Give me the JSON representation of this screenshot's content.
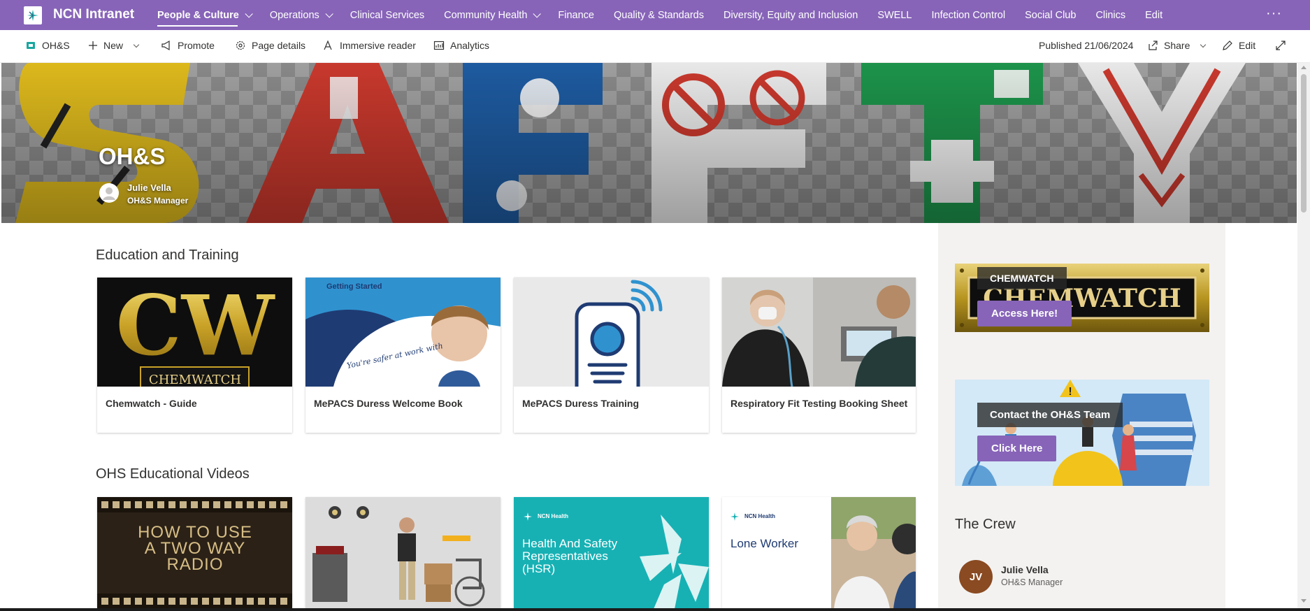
{
  "site": {
    "title": "NCN Intranet"
  },
  "nav": {
    "items": [
      {
        "label": "People & Culture",
        "dropdown": true,
        "active": true
      },
      {
        "label": "Operations",
        "dropdown": true
      },
      {
        "label": "Clinical Services"
      },
      {
        "label": "Community Health",
        "dropdown": true
      },
      {
        "label": "Finance"
      },
      {
        "label": "Quality & Standards"
      },
      {
        "label": "Diversity, Equity and Inclusion"
      },
      {
        "label": "SWELL"
      },
      {
        "label": "Infection Control"
      },
      {
        "label": "Social Club"
      },
      {
        "label": "Clinics"
      },
      {
        "label": "Edit"
      }
    ],
    "more": "···"
  },
  "toolbar": {
    "page_name": "OH&S",
    "new_label": "New",
    "promote_label": "Promote",
    "page_details_label": "Page details",
    "immersive_reader_label": "Immersive reader",
    "analytics_label": "Analytics",
    "published": "Published 21/06/2024",
    "share_label": "Share",
    "edit_label": "Edit"
  },
  "hero": {
    "title": "OH&S",
    "author_name": "Julie Vella",
    "author_role": "OH&S Manager"
  },
  "education": {
    "title": "Education and Training",
    "cards": [
      {
        "title": "Chemwatch - Guide",
        "thumb_text": "CW",
        "thumb_sub": "CHEMWATCH"
      },
      {
        "title": "MePACS Duress Welcome Book",
        "thumb_text": "Getting Started",
        "thumb_sub": "You're safer at work with"
      },
      {
        "title": "MePACS Duress Training"
      },
      {
        "title": "Respiratory Fit Testing Booking Sheet"
      }
    ]
  },
  "videos": {
    "title": "OHS Educational Videos",
    "cards": [
      {
        "line1": "HOW TO USE",
        "line2": "A TWO WAY",
        "line3": "RADIO"
      },
      {
        "caption": ""
      },
      {
        "heading": "Health And Safety Representatives (HSR)",
        "brand": "NCN Health"
      },
      {
        "heading": "Lone Worker",
        "brand": "NCN Health"
      }
    ]
  },
  "sidebar": {
    "chemwatch_label": "CHEMWATCH",
    "chemwatch_bg_text": "CHEMWATCH",
    "chemwatch_button": "Access Here!",
    "contact_label": "Contact the OH&S Team",
    "contact_button": "Click Here",
    "crew_title": "The Crew",
    "crew": [
      {
        "initials": "JV",
        "name": "Julie Vella",
        "role": "OH&S Manager"
      }
    ]
  }
}
